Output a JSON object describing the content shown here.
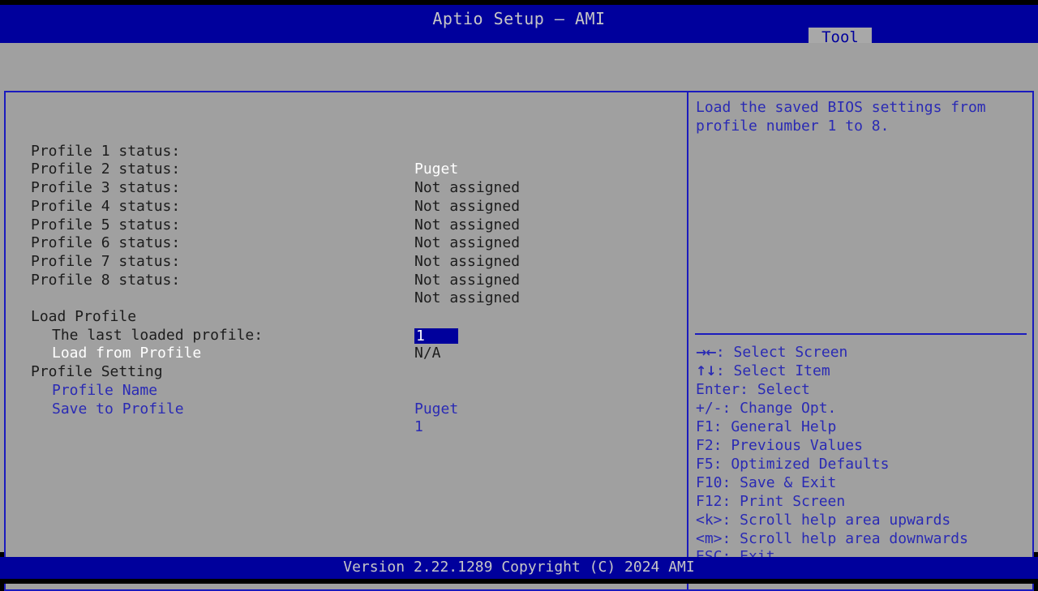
{
  "header": {
    "title": "Aptio Setup – AMI",
    "active_tab": "Tool"
  },
  "colors": {
    "title_bar_bg": "#00009c",
    "panel_bg": "#a0a0a0",
    "border_blue": "#1b1bbe",
    "text_blue": "#2a2ab4",
    "text_dark": "#1c1c1c",
    "text_white": "#ffffff",
    "highlight_bg": "#00009c"
  },
  "main": {
    "profile_status": [
      {
        "label": "Profile 1 status:",
        "value": "Puget"
      },
      {
        "label": "Profile 2 status:",
        "value": "Not assigned"
      },
      {
        "label": "Profile 3 status:",
        "value": "Not assigned"
      },
      {
        "label": "Profile 4 status:",
        "value": "Not assigned"
      },
      {
        "label": "Profile 5 status:",
        "value": "Not assigned"
      },
      {
        "label": "Profile 6 status:",
        "value": "Not assigned"
      },
      {
        "label": "Profile 7 status:",
        "value": "Not assigned"
      },
      {
        "label": "Profile 8 status:",
        "value": "Not assigned"
      }
    ],
    "load_profile_heading": "Load Profile",
    "last_loaded_profile": {
      "label": "The last loaded profile:",
      "value": "N/A"
    },
    "load_from_profile": {
      "label": "Load from Profile",
      "value": "1"
    },
    "profile_setting_heading": "Profile Setting",
    "profile_name": {
      "label": "Profile Name",
      "value": "Puget"
    },
    "save_to_profile": {
      "label": "Save to Profile",
      "value": "1"
    }
  },
  "help": {
    "description": "Load the saved BIOS settings from profile number 1 to 8.",
    "legend": [
      {
        "glyph": "→←",
        "text": ": Select Screen"
      },
      {
        "glyph": "↑↓",
        "text": ": Select Item"
      },
      {
        "glyph": "",
        "text": "Enter: Select"
      },
      {
        "glyph": "",
        "text": "+/-: Change Opt."
      },
      {
        "glyph": "",
        "text": "F1: General Help"
      },
      {
        "glyph": "",
        "text": "F2: Previous Values"
      },
      {
        "glyph": "",
        "text": "F5: Optimized Defaults"
      },
      {
        "glyph": "",
        "text": "F10: Save & Exit"
      },
      {
        "glyph": "",
        "text": "F12: Print Screen"
      },
      {
        "glyph": "",
        "text": "<k>: Scroll help area upwards"
      },
      {
        "glyph": "",
        "text": "<m>: Scroll help area downwards"
      },
      {
        "glyph": "",
        "text": "ESC: Exit"
      }
    ]
  },
  "footer": {
    "version": "Version 2.22.1289 Copyright (C) 2024 AMI"
  }
}
